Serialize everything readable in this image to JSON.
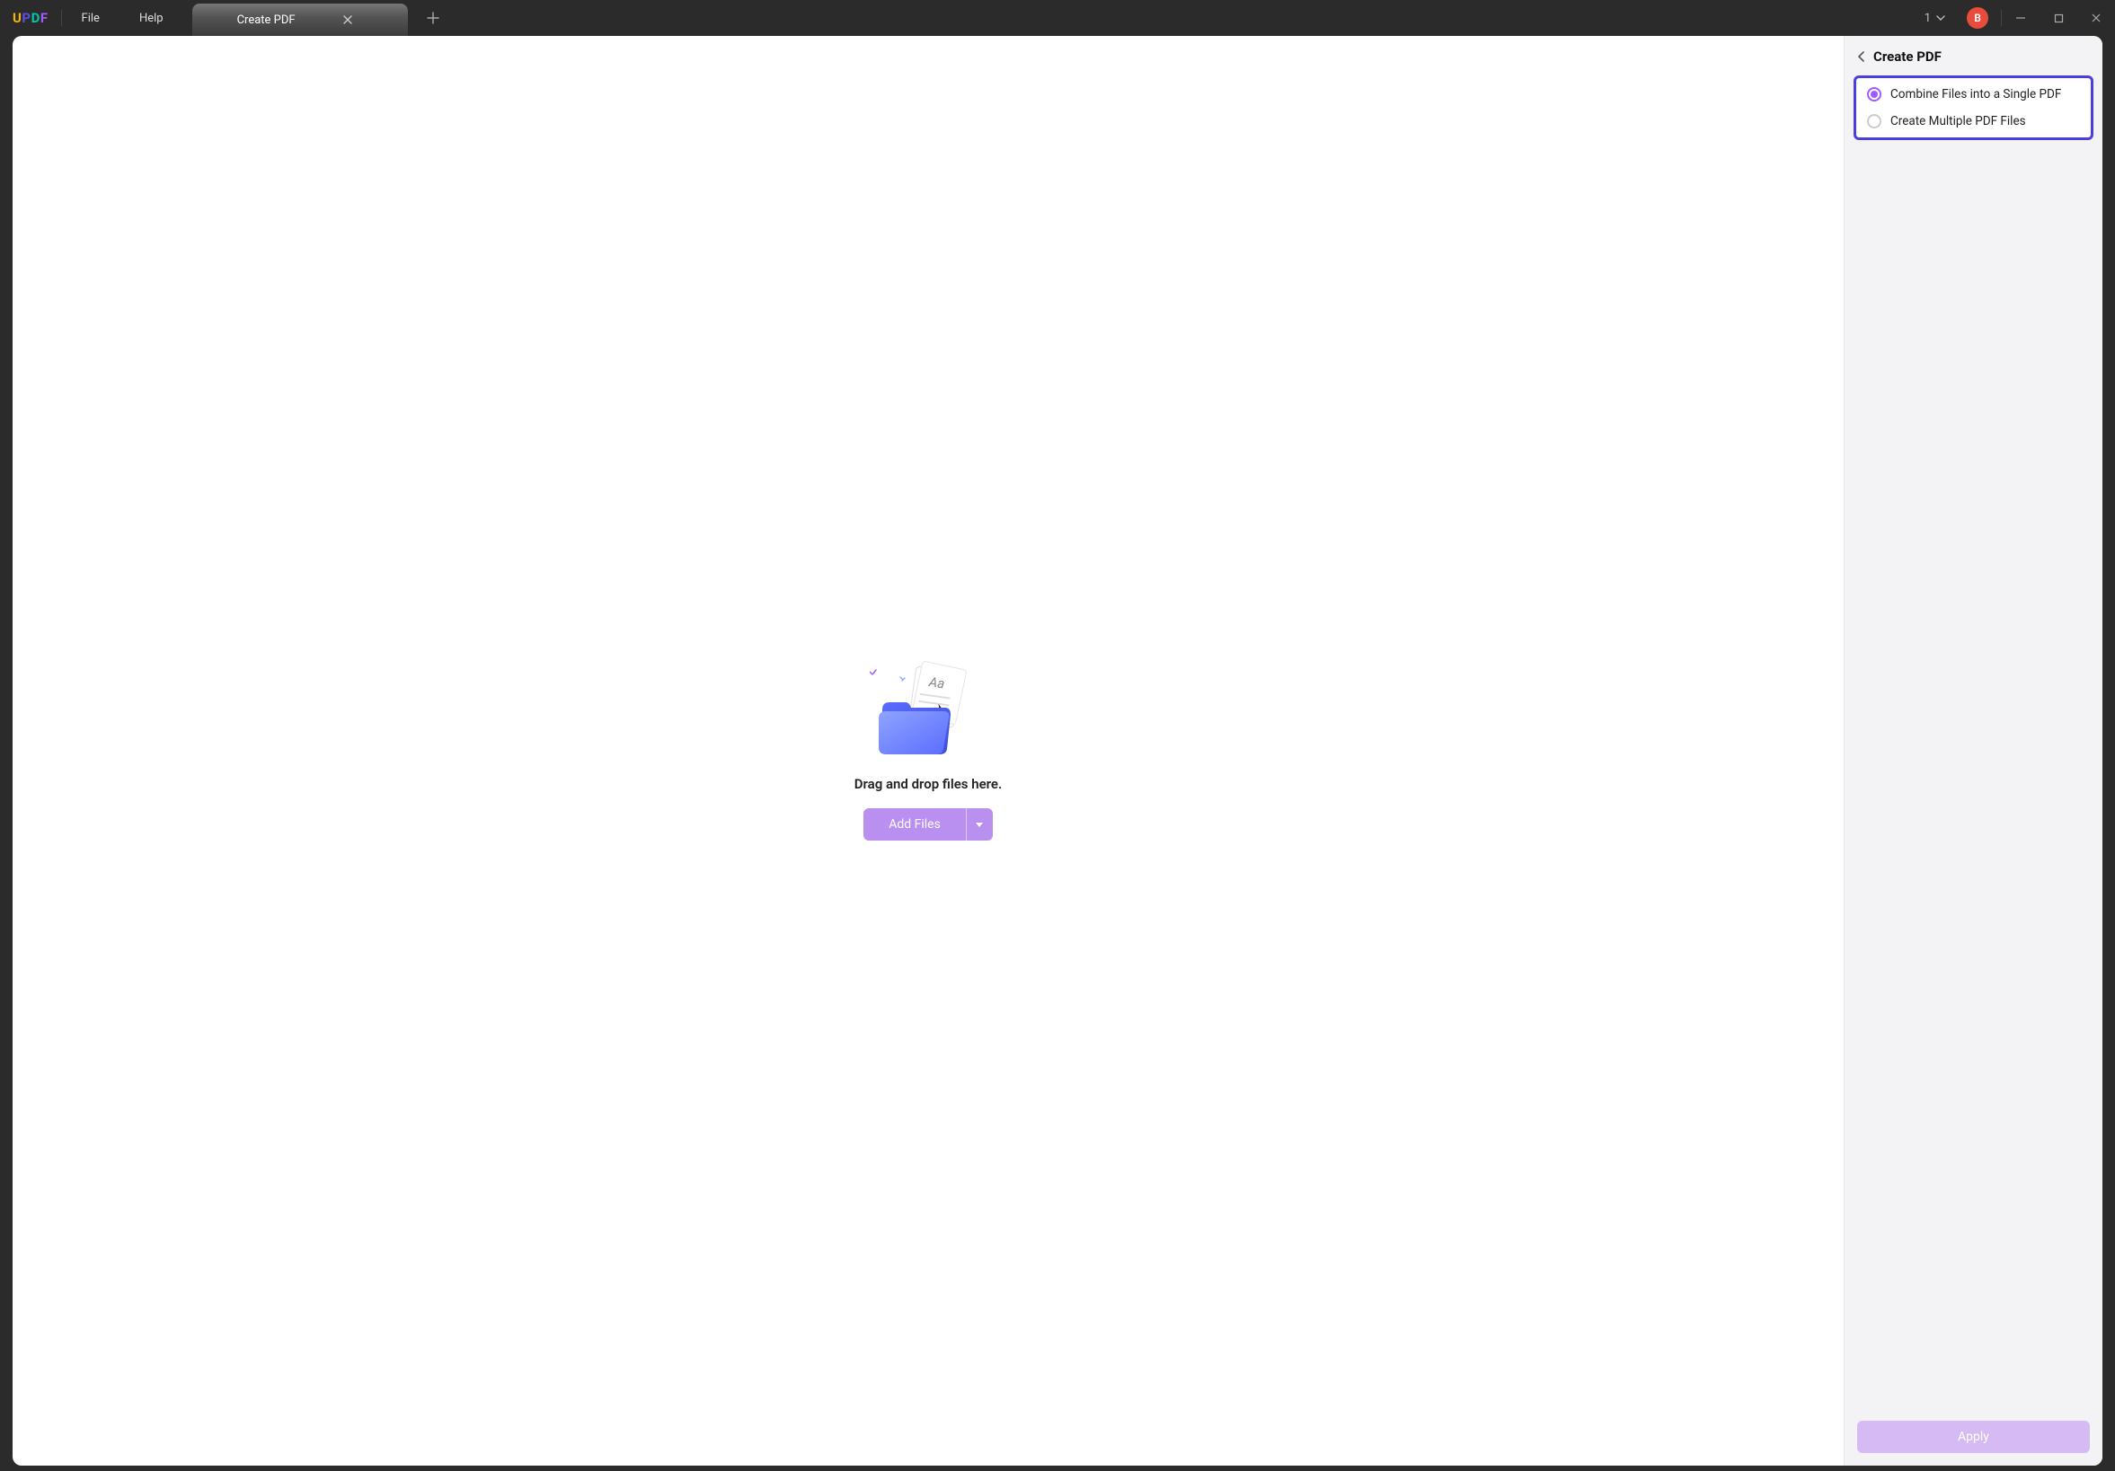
{
  "menu": {
    "file": "File",
    "help": "Help"
  },
  "tab": {
    "title": "Create PDF"
  },
  "titlebar": {
    "dropdown_value": "1",
    "avatar_initial": "B"
  },
  "main": {
    "drop_text": "Drag and drop files here.",
    "add_files_label": "Add Files"
  },
  "side": {
    "title": "Create PDF",
    "options": {
      "combine": "Combine Files into a Single PDF",
      "multiple": "Create Multiple PDF Files",
      "selected": "combine"
    },
    "apply_label": "Apply"
  }
}
